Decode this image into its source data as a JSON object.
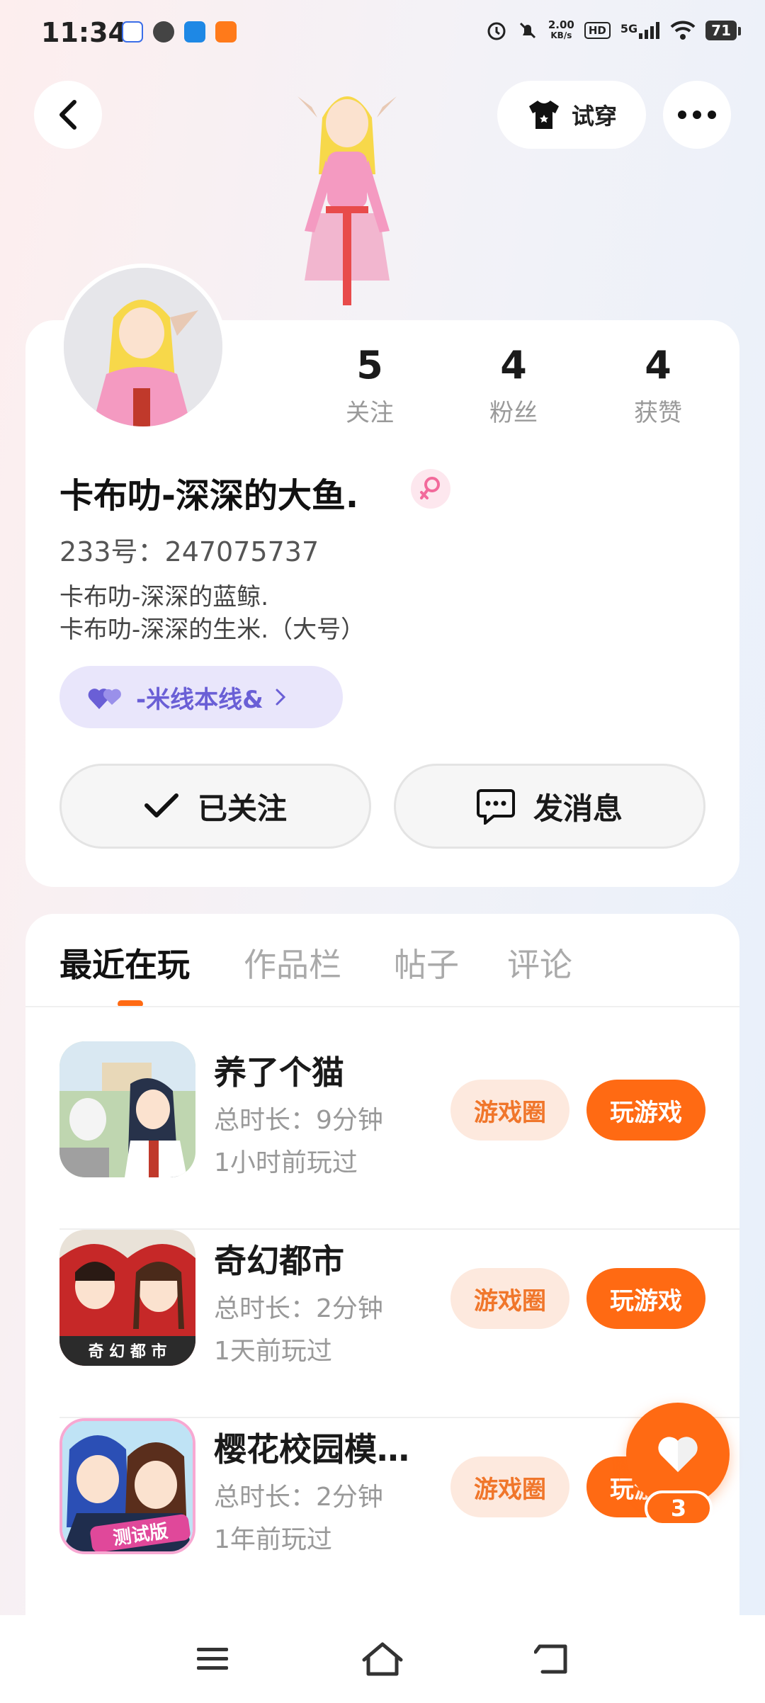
{
  "status_bar": {
    "time": "11:34",
    "net_speed_value": "2.00",
    "net_speed_unit": "KB/s",
    "hd": "HD",
    "signal": "5G",
    "battery": "71"
  },
  "header": {
    "tryon_label": "试穿"
  },
  "profile": {
    "stats": [
      {
        "value": "5",
        "label": "关注"
      },
      {
        "value": "4",
        "label": "粉丝"
      },
      {
        "value": "4",
        "label": "获赞"
      }
    ],
    "nickname": "卡布叻-深深的大鱼.",
    "uid": "233号：247075737",
    "bio_line1": "卡布叻-深深的蓝鲸.",
    "bio_line2": "卡布叻-深深的生米.（大号）",
    "tag_label": "-米线本线&",
    "follow_label": "已关注",
    "message_label": "发消息"
  },
  "tabs": [
    {
      "label": "最近在玩"
    },
    {
      "label": "作品栏"
    },
    {
      "label": "帖子"
    },
    {
      "label": "评论"
    }
  ],
  "games": [
    {
      "title": "养了个猫",
      "duration": "总时长：9分钟",
      "last_played": "1小时前玩过",
      "circle_label": "游戏圈",
      "play_label": "玩游戏"
    },
    {
      "title": "奇幻都市",
      "duration": "总时长：2分钟",
      "last_played": "1天前玩过",
      "circle_label": "游戏圈",
      "play_label": "玩游戏",
      "icon_text": "奇 幻 都 市"
    },
    {
      "title": "樱花校园模…",
      "duration": "总时长：2分钟",
      "last_played": "1年前玩过",
      "circle_label": "游戏圈",
      "play_label": "玩游戏",
      "icon_text": "测试版"
    }
  ],
  "like_fab": {
    "count": "3"
  },
  "colors": {
    "accent": "#ff6a13",
    "chip_bg": "#fde9de",
    "tag_bg": "#e9e6fb",
    "tag_text": "#6a5fd6"
  }
}
